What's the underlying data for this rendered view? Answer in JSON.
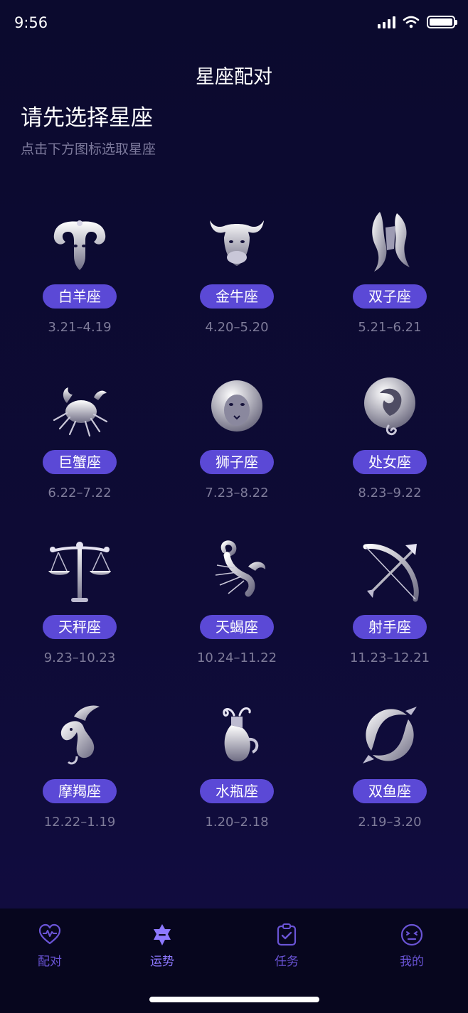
{
  "status_bar": {
    "time": "9:56"
  },
  "nav": {
    "title": "星座配对"
  },
  "intro": {
    "heading": "请先选择星座",
    "subheading": "点击下方图标选取星座"
  },
  "zodiacs": [
    {
      "name": "白羊座",
      "dates": "3.21–4.19",
      "icon": "aries-icon"
    },
    {
      "name": "金牛座",
      "dates": "4.20–5.20",
      "icon": "taurus-icon"
    },
    {
      "name": "双子座",
      "dates": "5.21–6.21",
      "icon": "gemini-icon"
    },
    {
      "name": "巨蟹座",
      "dates": "6.22–7.22",
      "icon": "cancer-icon"
    },
    {
      "name": "狮子座",
      "dates": "7.23–8.22",
      "icon": "leo-icon"
    },
    {
      "name": "处女座",
      "dates": "8.23–9.22",
      "icon": "virgo-icon"
    },
    {
      "name": "天秤座",
      "dates": "9.23–10.23",
      "icon": "libra-icon"
    },
    {
      "name": "天蝎座",
      "dates": "10.24–11.22",
      "icon": "scorpio-icon"
    },
    {
      "name": "射手座",
      "dates": "11.23–12.21",
      "icon": "sagittarius-icon"
    },
    {
      "name": "摩羯座",
      "dates": "12.22–1.19",
      "icon": "capricorn-icon"
    },
    {
      "name": "水瓶座",
      "dates": "1.20–2.18",
      "icon": "aquarius-icon"
    },
    {
      "name": "双鱼座",
      "dates": "2.19–3.20",
      "icon": "pisces-icon"
    }
  ],
  "tab_bar": {
    "items": [
      {
        "label": "配对",
        "icon": "heart-pulse-icon"
      },
      {
        "label": "运势",
        "icon": "star-badge-icon",
        "active": true
      },
      {
        "label": "任务",
        "icon": "clipboard-check-icon"
      },
      {
        "label": "我的",
        "icon": "face-icon"
      }
    ]
  },
  "colors": {
    "background": "#0c0a30",
    "pill": "#5b49d6",
    "tab_accent": "#6a54d6",
    "muted_text": "#7e7b99"
  }
}
